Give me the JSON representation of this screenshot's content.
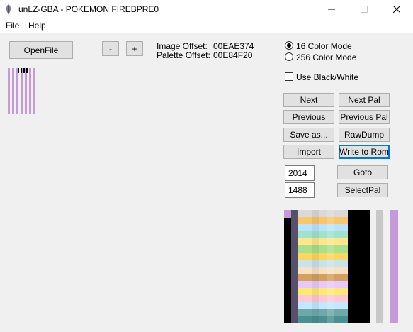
{
  "window": {
    "title": "unLZ-GBA - POKEMON FIREBPRE0",
    "app_icon": "feather-icon",
    "controls": [
      "minimize-icon",
      "maximize-icon",
      "close-icon"
    ]
  },
  "menu": {
    "file": "File",
    "help": "Help"
  },
  "toolbar": {
    "open_file": "OpenFile",
    "minus": "-",
    "plus": "+"
  },
  "offsets": {
    "image_label": "Image Offset:",
    "image_value": "00EAE374",
    "palette_label": "Palette Offset:",
    "palette_value": "00E84F20"
  },
  "modes": {
    "color16": "16 Color Mode",
    "color256": "256 Color Mode",
    "selected": "16 Color Mode",
    "bw": "Use Black/White",
    "bw_checked": false
  },
  "buttons": {
    "next": "Next",
    "next_pal": "Next Pal",
    "previous": "Previous",
    "previous_pal": "Previous Pal",
    "save_as": "Save as...",
    "raw_dump": "RawDump",
    "import": "Import",
    "write_to_rom": "Write to Rom",
    "goto": "Goto",
    "select_pal": "SelectPal"
  },
  "inputs": {
    "field1": "2014",
    "field2": "1488"
  },
  "colors": {
    "thumb_lavender": "#c59ad8",
    "preview_dark": "#57506a",
    "preview_black": "#000000"
  }
}
